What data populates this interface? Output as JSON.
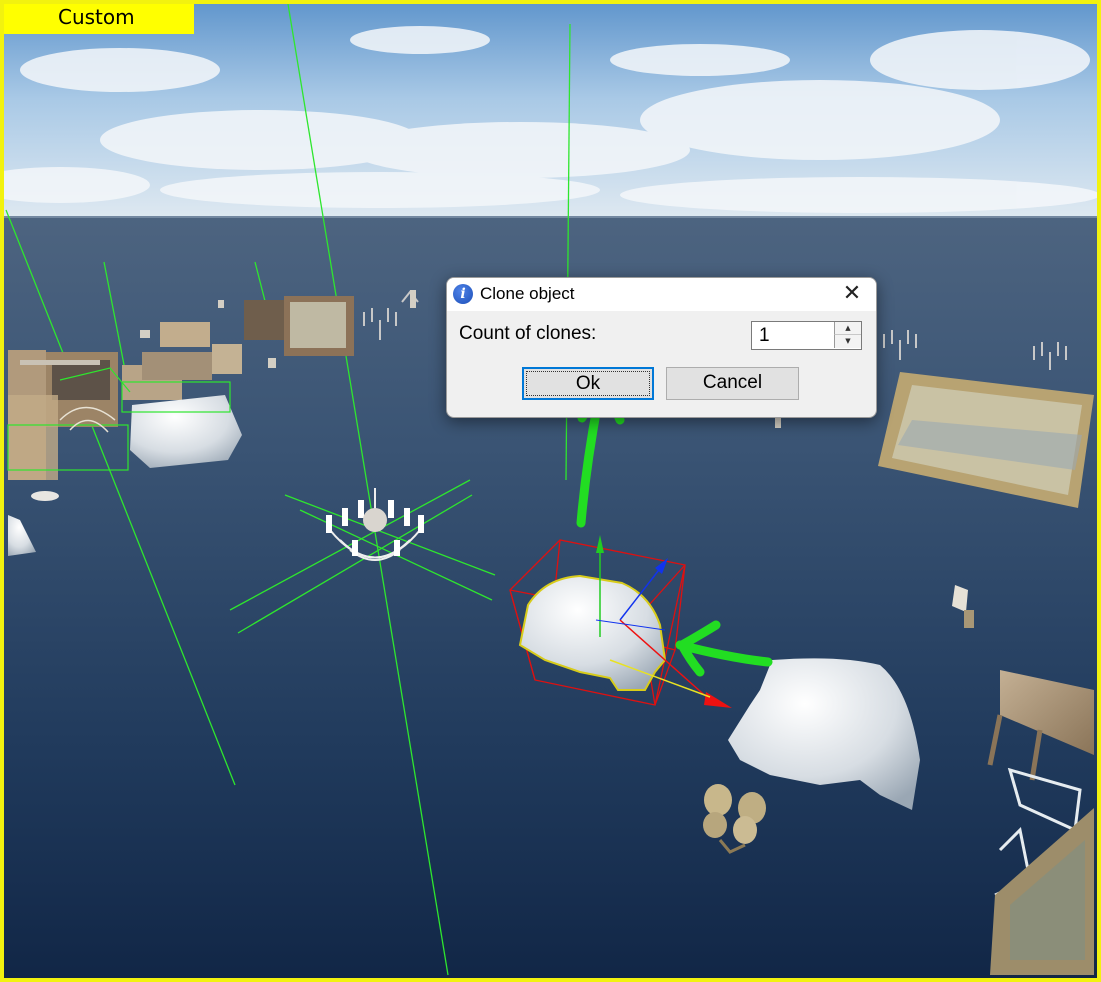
{
  "viewport": {
    "mode_label": "Custom",
    "accent_color": "#ffff00"
  },
  "dialog": {
    "title": "Clone object",
    "icon": "info-icon",
    "close_icon": "close-icon",
    "count_label": "Count of clones:",
    "count_value": "1",
    "ok_label": "Ok",
    "cancel_label": "Cancel"
  },
  "annotations": {
    "color": "#22dd22",
    "marks": [
      "checkmark-icon",
      "arrow-up-icon",
      "arrow-left-icon"
    ]
  },
  "selection": {
    "bbox_color": "#dd1111",
    "gizmo_colors": {
      "x": "#ee1111",
      "y": "#22cc22",
      "z": "#1133ee"
    }
  }
}
